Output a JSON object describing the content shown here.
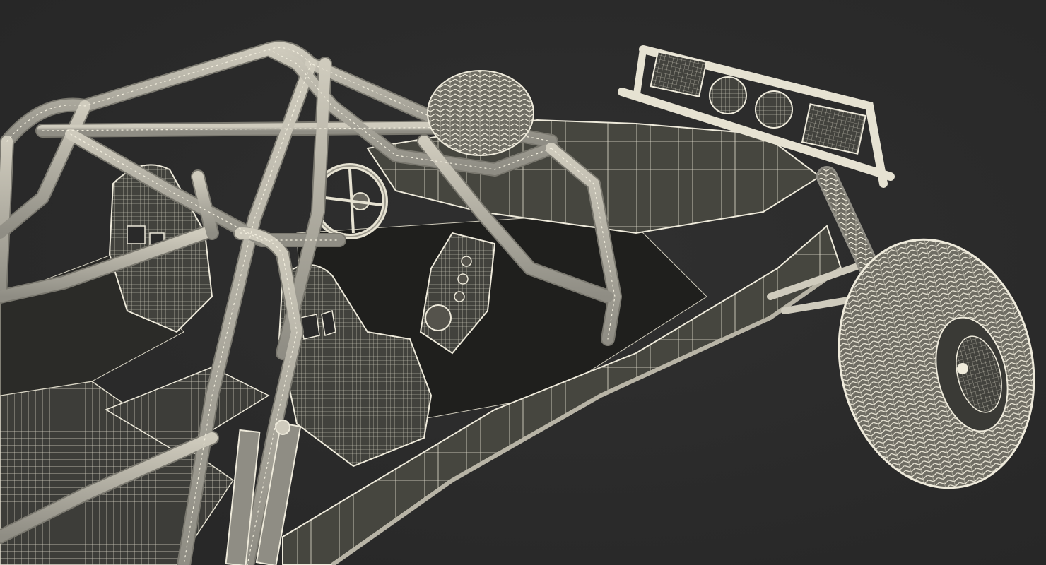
{
  "scene": {
    "background_color": "#2a2a2a",
    "wire_color": "#e6e2d2",
    "surface_color": "#3a3a36",
    "surface_light_color": "#4a4a45",
    "shadow_color": "#1e1e1c"
  },
  "icons": [
    "steering-wheel-icon",
    "gauge-icon",
    "tire-icon",
    "seat-icon",
    "headlight-icon"
  ]
}
